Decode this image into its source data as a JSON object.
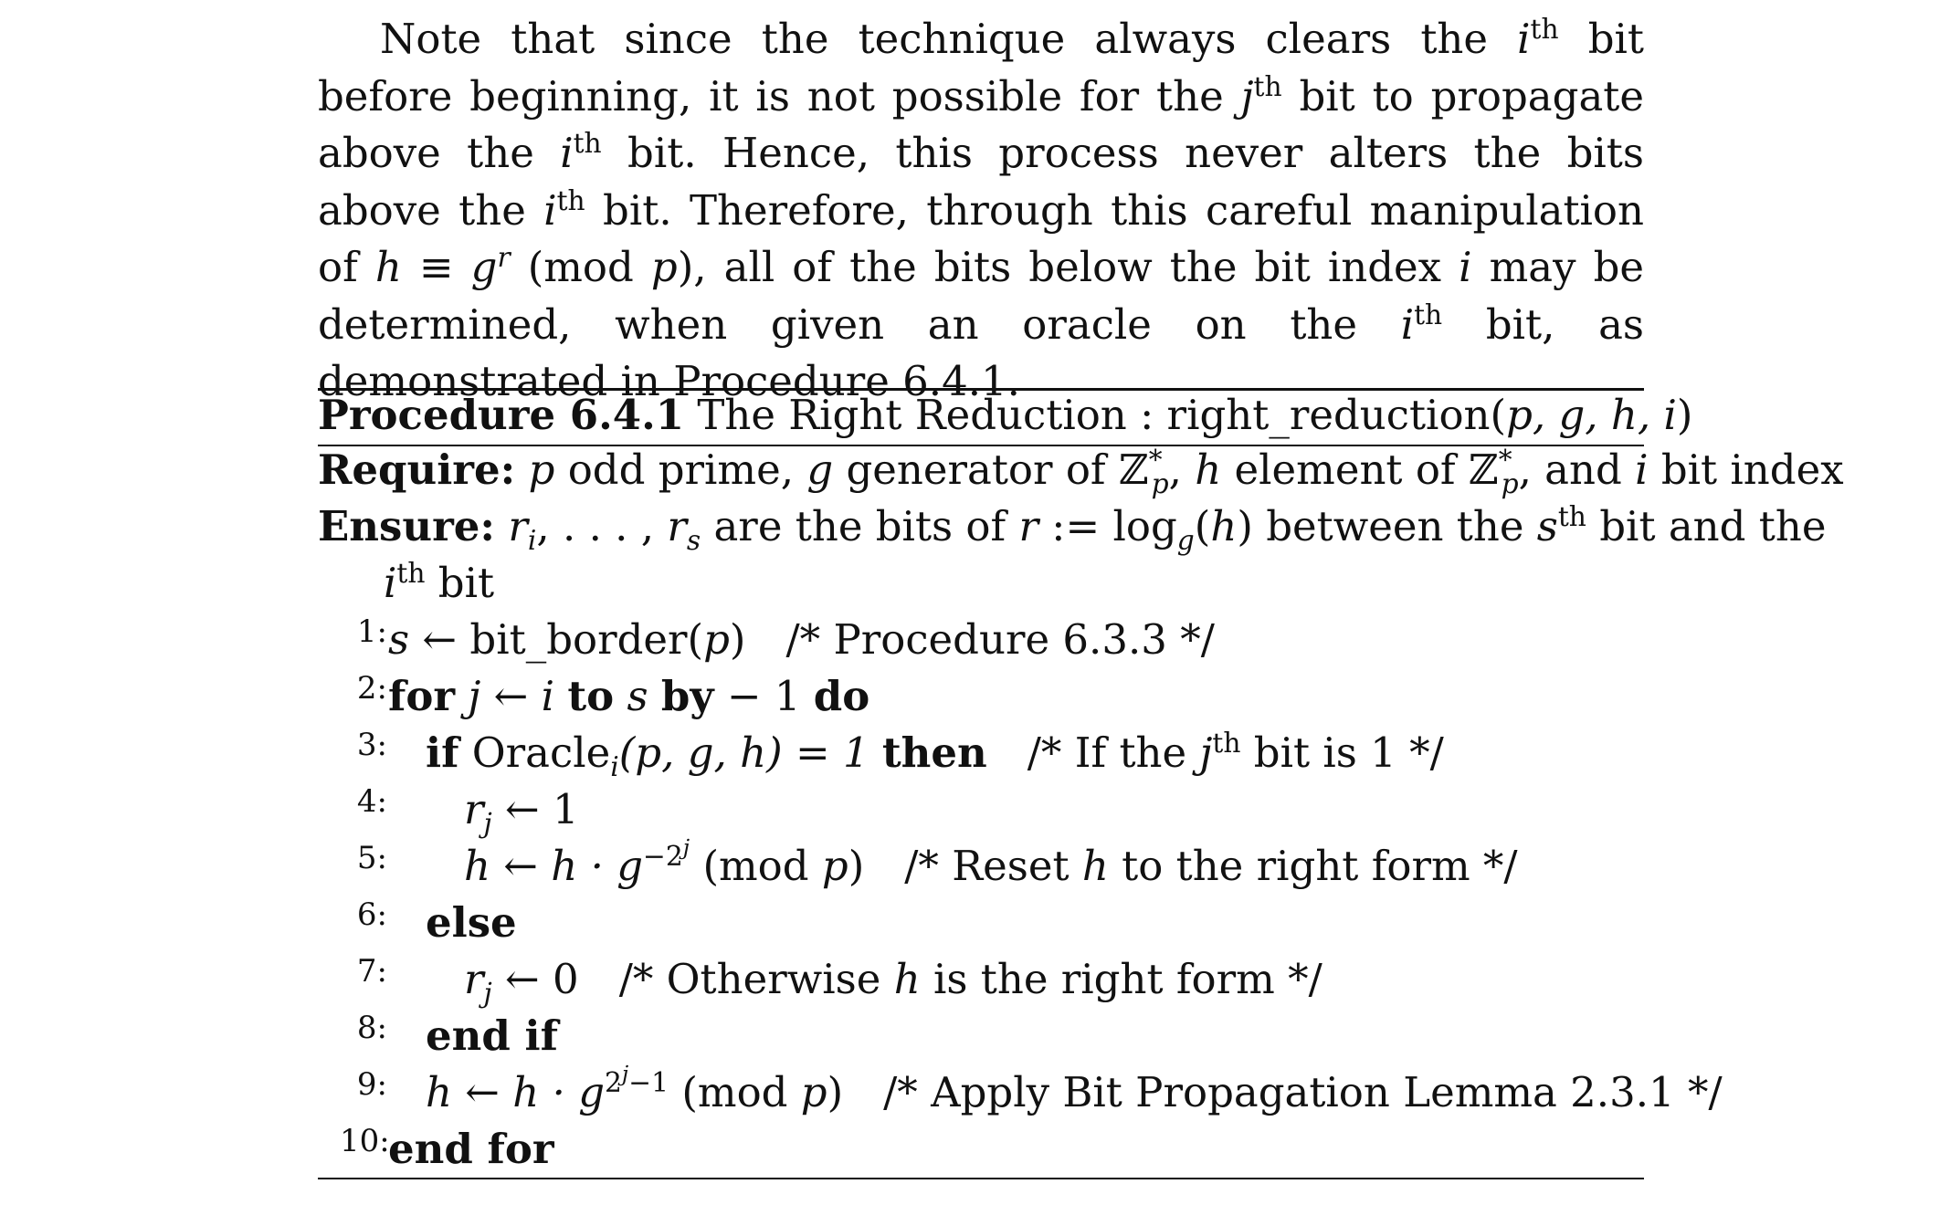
{
  "paragraph": {
    "t1": "Note that since the technique always clears the ",
    "i": "i",
    "th": "th",
    "t2": " bit before beginning, it is not possible for the ",
    "j": "j",
    "t3": " bit to propagate above the ",
    "t4": " bit. Hence, this process never alters the bits above the ",
    "t5": " bit. Therefore, through this careful manipulation of ",
    "h": "h",
    "equiv": " ≡ ",
    "g": "g",
    "r": "r",
    "mod": " (mod ",
    "p": "p",
    "t6": "), all of the bits below the bit index ",
    "t7": " may be determined, when given an oracle on the ",
    "t8": " bit, as demonstrated in Procedure 6.4.1."
  },
  "procedure": {
    "label": "Procedure 6.4.1",
    "title": " The Right Reduction : right_reduction(",
    "args": "p, g, h, i",
    "close": ")",
    "require_label": "Require:",
    "require_a": " odd prime, ",
    "require_b": " generator of ℤ",
    "star": "*",
    "require_c": ", ",
    "require_d": " element of ℤ",
    "require_e": ", and ",
    "require_f": " bit index",
    "ensure_label": "Ensure:",
    "ensure_ri": "r",
    "ensure_a": ", . . . , ",
    "ensure_b": " are the bits of ",
    "ensure_c": " := log",
    "ensure_d": "(",
    "ensure_e": ") between the ",
    "ensure_s": "s",
    "ensure_f": " bit and the",
    "ensure_g": " bit"
  },
  "lines": [
    {
      "num": "1:",
      "a": "s",
      "b": " ← bit_border(",
      "c": "p",
      "d": ")",
      "comment": "/* Procedure 6.3.3 */"
    },
    {
      "num": "2:",
      "kw1": "for",
      "a": " j ← i ",
      "kw2": "to",
      "b": " s ",
      "kw3": "by",
      "c": " − 1 ",
      "kw4": "do"
    },
    {
      "num": "3:",
      "kw1": "if",
      "a": " Oracle",
      "sub": "i",
      "b": "(p, g, h) = 1 ",
      "kw2": "then",
      "comment_a": "/* If the ",
      "comment_j": "j",
      "comment_th": "th",
      "comment_b": " bit is 1 */"
    },
    {
      "num": "4:",
      "a": "r",
      "sub": "j",
      "b": " ← 1"
    },
    {
      "num": "5:",
      "a": "h ← h · g",
      "sup": "−2",
      "supj": "j",
      "b": " (mod ",
      "c": "p",
      "d": ")",
      "comment_a": "/* Reset ",
      "comment_h": "h",
      "comment_b": " to the right form */"
    },
    {
      "num": "6:",
      "kw1": "else"
    },
    {
      "num": "7:",
      "a": "r",
      "sub": "j",
      "b": " ← 0",
      "comment_a": "/* Otherwise ",
      "comment_h": "h",
      "comment_b": " is the right form */"
    },
    {
      "num": "8:",
      "kw1": "end if"
    },
    {
      "num": "9:",
      "a": "h ← h · g",
      "sup": "2",
      "supj": "j",
      "sup2": "−1",
      "b": " (mod ",
      "c": "p",
      "d": ")",
      "comment": "/* Apply Bit Propagation Lemma 2.3.1 */"
    },
    {
      "num": "10:",
      "kw1": "end for"
    }
  ]
}
